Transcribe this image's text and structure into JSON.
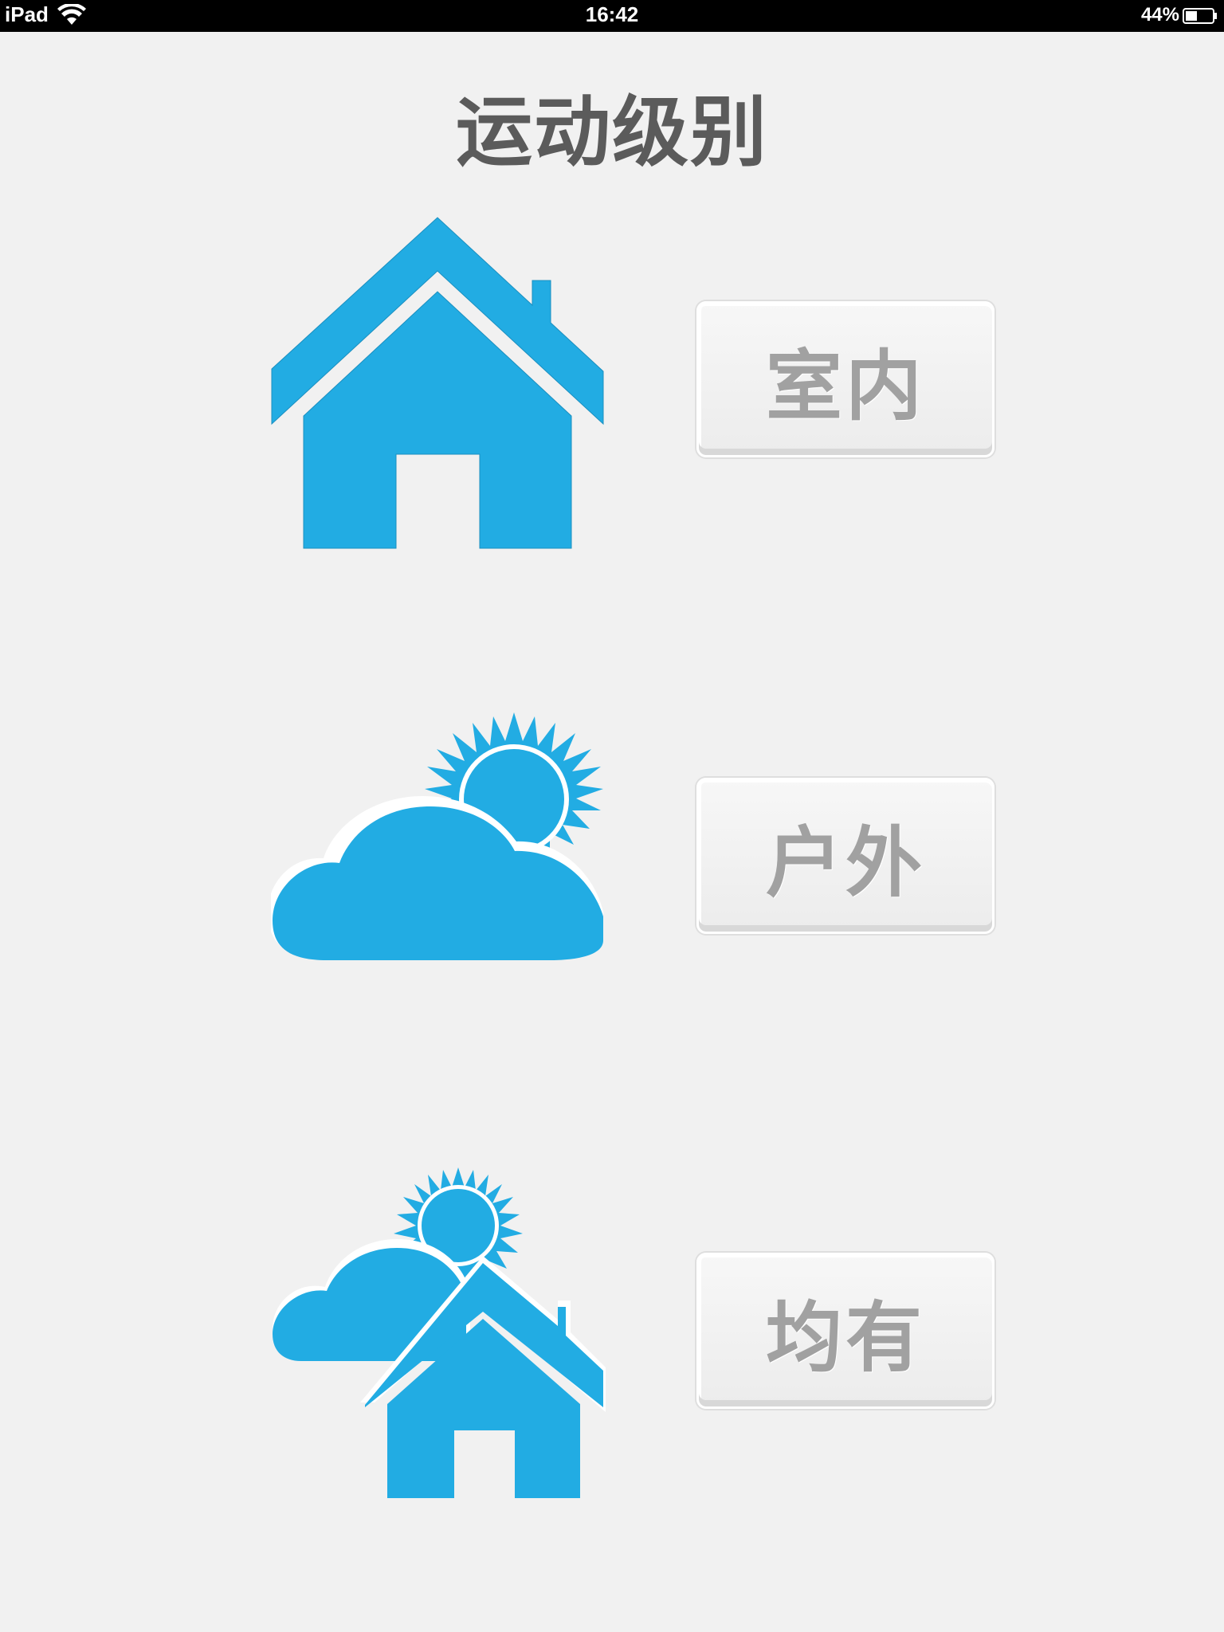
{
  "status_bar": {
    "carrier": "iPad",
    "time": "16:42",
    "battery_percent": "44%"
  },
  "page": {
    "title": "运动级别"
  },
  "options": [
    {
      "label": "室内",
      "icon": "house-icon"
    },
    {
      "label": "户外",
      "icon": "cloud-sun-icon"
    },
    {
      "label": "均有",
      "icon": "cloud-sun-house-icon"
    }
  ],
  "colors": {
    "background": "#f1f1f1",
    "accent_blue": "#22ace3",
    "title_text": "#5b5b5b",
    "button_text": "#a1a1a1"
  }
}
